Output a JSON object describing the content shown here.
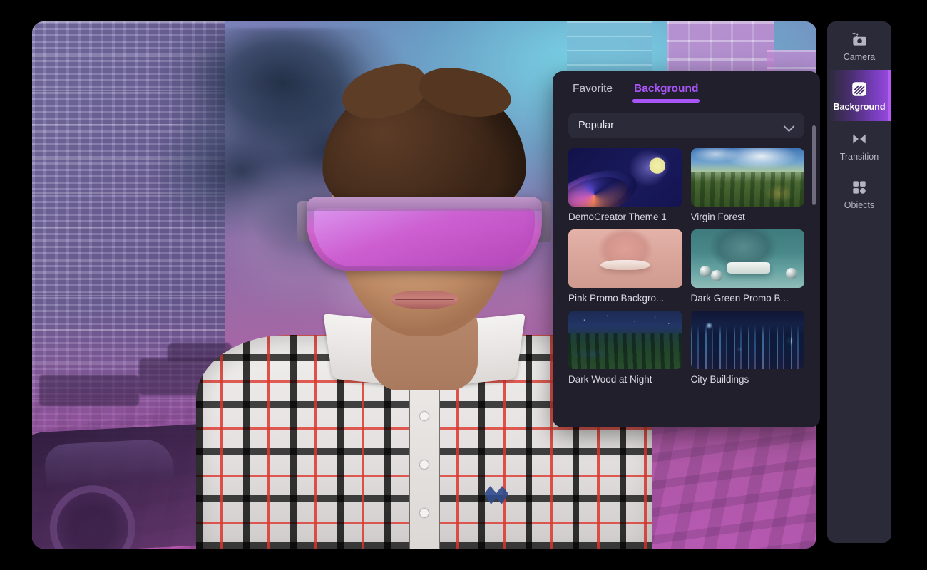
{
  "sidebar": {
    "items": [
      {
        "label": "Camera",
        "icon": "camera-sparkle-icon",
        "active": false
      },
      {
        "label": "Background",
        "icon": "background-hatch-icon",
        "active": true
      },
      {
        "label": "Transition",
        "icon": "transition-icon",
        "active": false
      },
      {
        "label": "Obiects",
        "icon": "objects-grid-icon",
        "active": false
      }
    ]
  },
  "panel": {
    "tabs": [
      {
        "label": "Favorite",
        "active": false
      },
      {
        "label": "Background",
        "active": true
      }
    ],
    "category_select": {
      "value": "Popular",
      "icon": "chevron-down-icon"
    },
    "items": [
      {
        "label": "DemoCreator Theme 1",
        "art": "demo"
      },
      {
        "label": "Virgin Forest",
        "art": "forest"
      },
      {
        "label": "Pink Promo Backgro...",
        "art": "pink"
      },
      {
        "label": "Dark Green Promo B...",
        "art": "green"
      },
      {
        "label": "Dark Wood at Night",
        "art": "night"
      },
      {
        "label": "City Buildings",
        "art": "city"
      }
    ]
  },
  "colors": {
    "accent": "#a855f7",
    "accent_edge": "#b45cf5",
    "panel_bg": "#201f2b",
    "sidebar_bg": "#2b2a38",
    "text_primary": "#e6e5ee",
    "text_muted": "#b6b4c2",
    "page_bg": "#000000"
  }
}
